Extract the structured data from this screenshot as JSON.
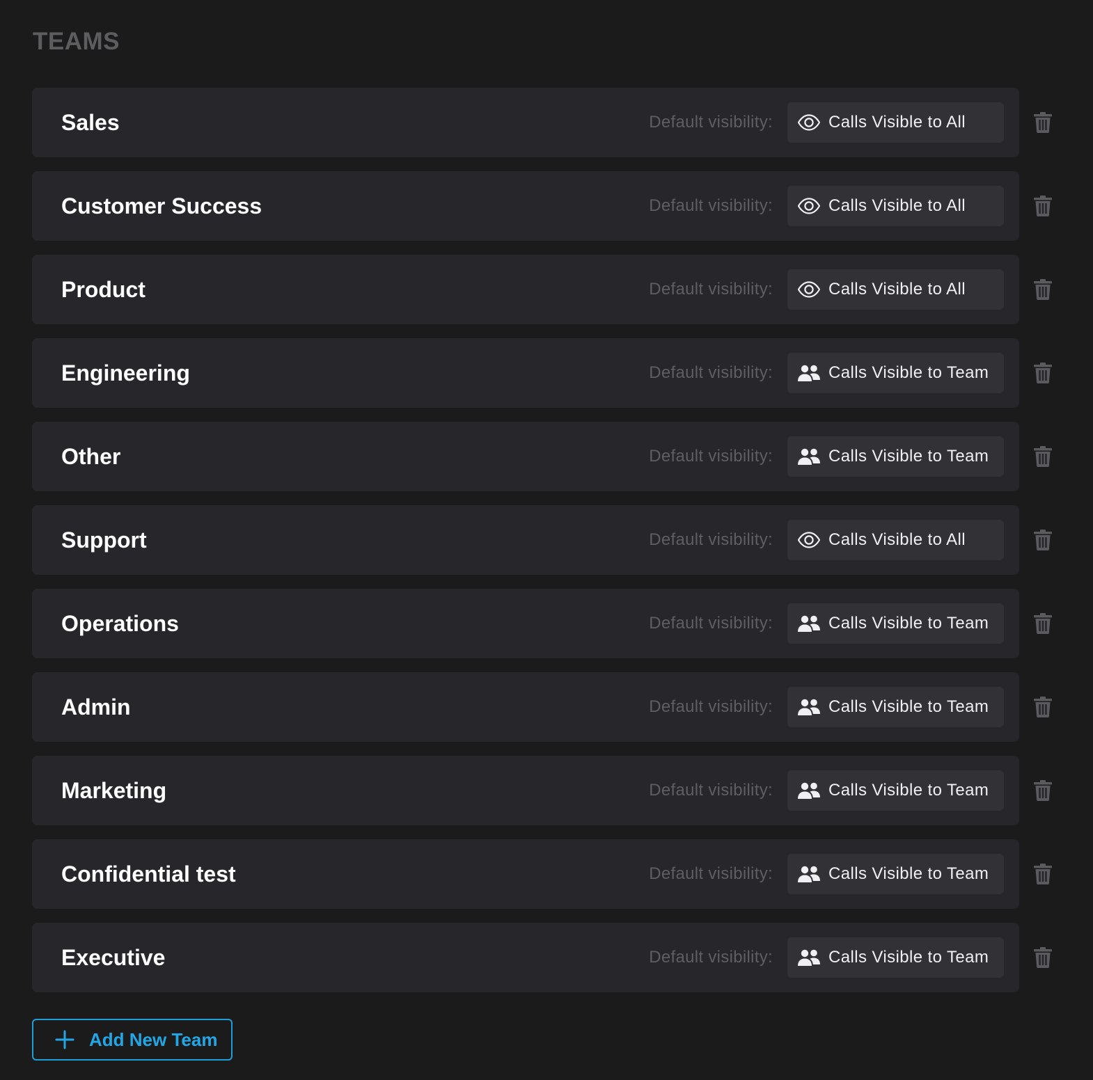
{
  "section": {
    "title": "TEAMS"
  },
  "visibility_label": "Default visibility:",
  "visibility_options": {
    "all": {
      "label": "Calls Visible to All",
      "icon": "eye-icon"
    },
    "team": {
      "label": "Calls Visible to Team",
      "icon": "users-icon"
    }
  },
  "teams": [
    {
      "name": "Sales",
      "visibility": "all"
    },
    {
      "name": "Customer Success",
      "visibility": "all"
    },
    {
      "name": "Product",
      "visibility": "all"
    },
    {
      "name": "Engineering",
      "visibility": "team"
    },
    {
      "name": "Other",
      "visibility": "team"
    },
    {
      "name": "Support",
      "visibility": "all"
    },
    {
      "name": "Operations",
      "visibility": "team"
    },
    {
      "name": "Admin",
      "visibility": "team"
    },
    {
      "name": "Marketing",
      "visibility": "team"
    },
    {
      "name": "Confidential test",
      "visibility": "team"
    },
    {
      "name": "Executive",
      "visibility": "team"
    }
  ],
  "add_button": {
    "label": "Add New Team",
    "icon": "plus-icon"
  },
  "colors": {
    "background": "#1b1b1c",
    "card": "#26262b",
    "pill": "#313136",
    "accent": "#22a7e6",
    "muted": "#5e5e63"
  }
}
